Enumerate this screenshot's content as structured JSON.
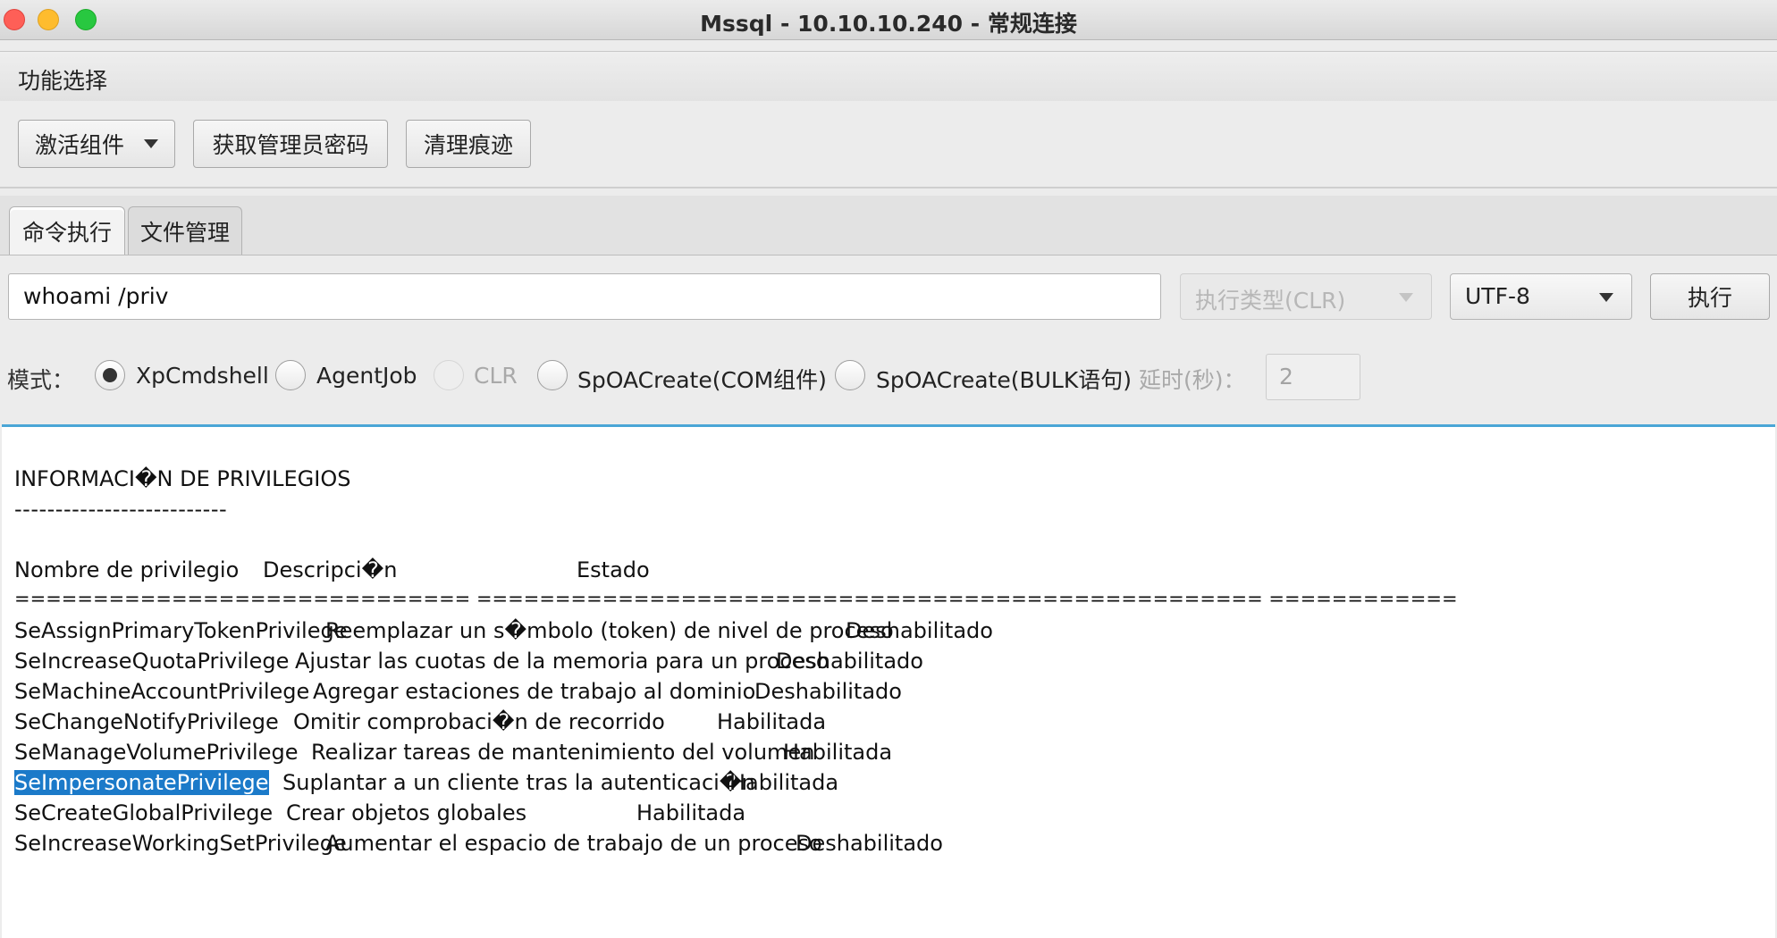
{
  "window": {
    "title": "Mssql - 10.10.10.240 - 常规连接"
  },
  "menu": {
    "function_select": "功能选择"
  },
  "toolbar": {
    "activate_components": "激活组件",
    "get_admin_password": "获取管理员密码",
    "clear_traces": "清理痕迹"
  },
  "tabs": [
    {
      "label": "命令执行",
      "active": true
    },
    {
      "label": "文件管理",
      "active": false
    }
  ],
  "command": {
    "input_value": "whoami /priv",
    "exec_type": "执行类型(CLR)",
    "encoding": "UTF-8",
    "execute_label": "执行"
  },
  "mode": {
    "label": "模式：",
    "options": [
      {
        "label": "XpCmdshell",
        "checked": true,
        "disabled": false
      },
      {
        "label": "AgentJob",
        "checked": false,
        "disabled": false
      },
      {
        "label": "CLR",
        "checked": false,
        "disabled": true
      },
      {
        "label": "SpOACreate(COM组件)",
        "checked": false,
        "disabled": false
      },
      {
        "label": "SpOACreate(BULK语句)",
        "checked": false,
        "disabled": false
      }
    ],
    "delay_label": "延时(秒)：",
    "delay_value": "2"
  },
  "output": {
    "title": "INFORMACI�N DE PRIVILEGIOS",
    "underline": "--------------------------",
    "headers": {
      "name": "Nombre de privilegio",
      "description": "Descripci�n",
      "state": "Estado"
    },
    "separator": "============================= ================================================== ============",
    "rows": [
      {
        "name": "SeAssignPrimaryTokenPrivilege",
        "description": "Reemplazar un s�mbolo (token) de nivel de proceso",
        "state": "Deshabilitado",
        "selected": false
      },
      {
        "name": "SeIncreaseQuotaPrivilege",
        "description": "Ajustar las cuotas de la memoria para un proceso",
        "state": "Deshabilitado",
        "selected": false
      },
      {
        "name": "SeMachineAccountPrivilege",
        "description": "Agregar estaciones de trabajo al dominio",
        "state": "Deshabilitado",
        "selected": false
      },
      {
        "name": "SeChangeNotifyPrivilege",
        "description": "Omitir comprobaci�n de recorrido",
        "state": "Habilitada",
        "selected": false
      },
      {
        "name": "SeManageVolumePrivilege",
        "description": "Realizar tareas de mantenimiento del volumen",
        "state": "Habilitada",
        "selected": false
      },
      {
        "name": "SeImpersonatePrivilege",
        "description": "Suplantar a un cliente tras la autenticaci�n",
        "state": "Habilitada",
        "selected": true
      },
      {
        "name": "SeCreateGlobalPrivilege",
        "description": "Crear objetos globales",
        "state": "Habilitada",
        "selected": false
      },
      {
        "name": "SeIncreaseWorkingSetPrivilege",
        "description": "Aumentar el espacio de trabajo de un proceso",
        "state": "Deshabilitado",
        "selected": false
      }
    ]
  }
}
